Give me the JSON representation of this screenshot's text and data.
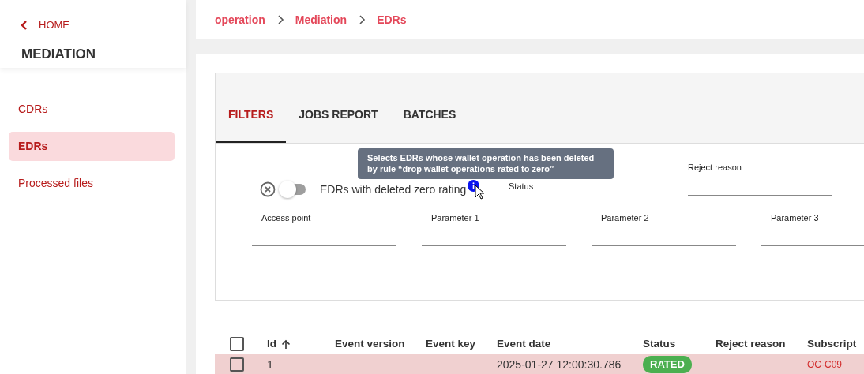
{
  "sidebar": {
    "back_link": "HOME",
    "title": "MEDIATION",
    "items": [
      {
        "label": "CDRs",
        "selected": false
      },
      {
        "label": "EDRs",
        "selected": true
      },
      {
        "label": "Processed files",
        "selected": false
      }
    ]
  },
  "breadcrumb": [
    "operation",
    "Mediation",
    "EDRs"
  ],
  "tabs": [
    {
      "label": "FILTERS",
      "selected": true
    },
    {
      "label": "JOBS REPORT",
      "selected": false
    },
    {
      "label": "BATCHES",
      "selected": false
    }
  ],
  "filters": {
    "toggle": {
      "label": "EDRs with deleted zero rating",
      "checked": false,
      "tooltip": "Selects EDRs whose wallet operation has been deleted by rule “drop wallet operations rated to zero”"
    },
    "row_1": [
      {
        "label": "Status"
      },
      {
        "label": "Reject reason"
      }
    ],
    "row_2": [
      {
        "label": "Access point"
      },
      {
        "label": "Parameter 1"
      },
      {
        "label": "Parameter 2"
      },
      {
        "label": "Parameter 3"
      }
    ]
  },
  "table": {
    "all_selected": false,
    "columns": [
      {
        "label": "Id",
        "sorted": true
      },
      {
        "label": "Event version"
      },
      {
        "label": "Event key"
      },
      {
        "label": "Event date"
      },
      {
        "label": "Status"
      },
      {
        "label": "Reject reason"
      },
      {
        "label": "Subscript"
      }
    ],
    "rows": [
      {
        "selected": false,
        "cells": [
          "1",
          "",
          "",
          "2025-01-27 12:00:30.786",
          "RATED",
          "",
          "OC-C09"
        ]
      }
    ]
  }
}
